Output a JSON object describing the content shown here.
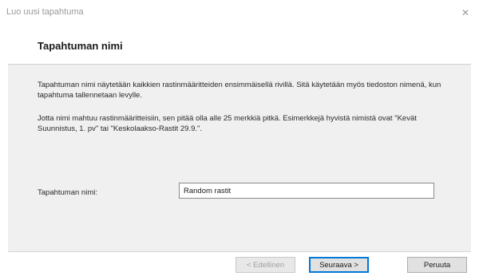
{
  "window": {
    "title": "Luo uusi tapahtuma",
    "close_glyph": "✕"
  },
  "page": {
    "title": "Tapahtuman nimi",
    "paragraph_1": "Tapahtuman nimi näytetään kaikkien rastinmääritteiden ensimmäisellä rivillä. Sitä käytetään myös tiedoston nimenä, kun tapahtuma tallennetaan levylle.",
    "paragraph_2": "Jotta nimi mahtuu rastinmääritteisiin, sen pitää olla alle 25 merkkiä pitkä. Esimerkkejä hyvistä nimistä ovat \"Kevät Suunnistus, 1. pv\" tai \"Keskolaakso-Rastit 29.9.\"."
  },
  "form": {
    "name_label": "Tapahtuman nimi:",
    "name_value": "Random rastit"
  },
  "buttons": {
    "back": "< Edellinen",
    "next": "Seuraava >",
    "cancel": "Peruuta"
  },
  "colors": {
    "accent": "#0078d7",
    "panel": "#f0f0f0"
  }
}
